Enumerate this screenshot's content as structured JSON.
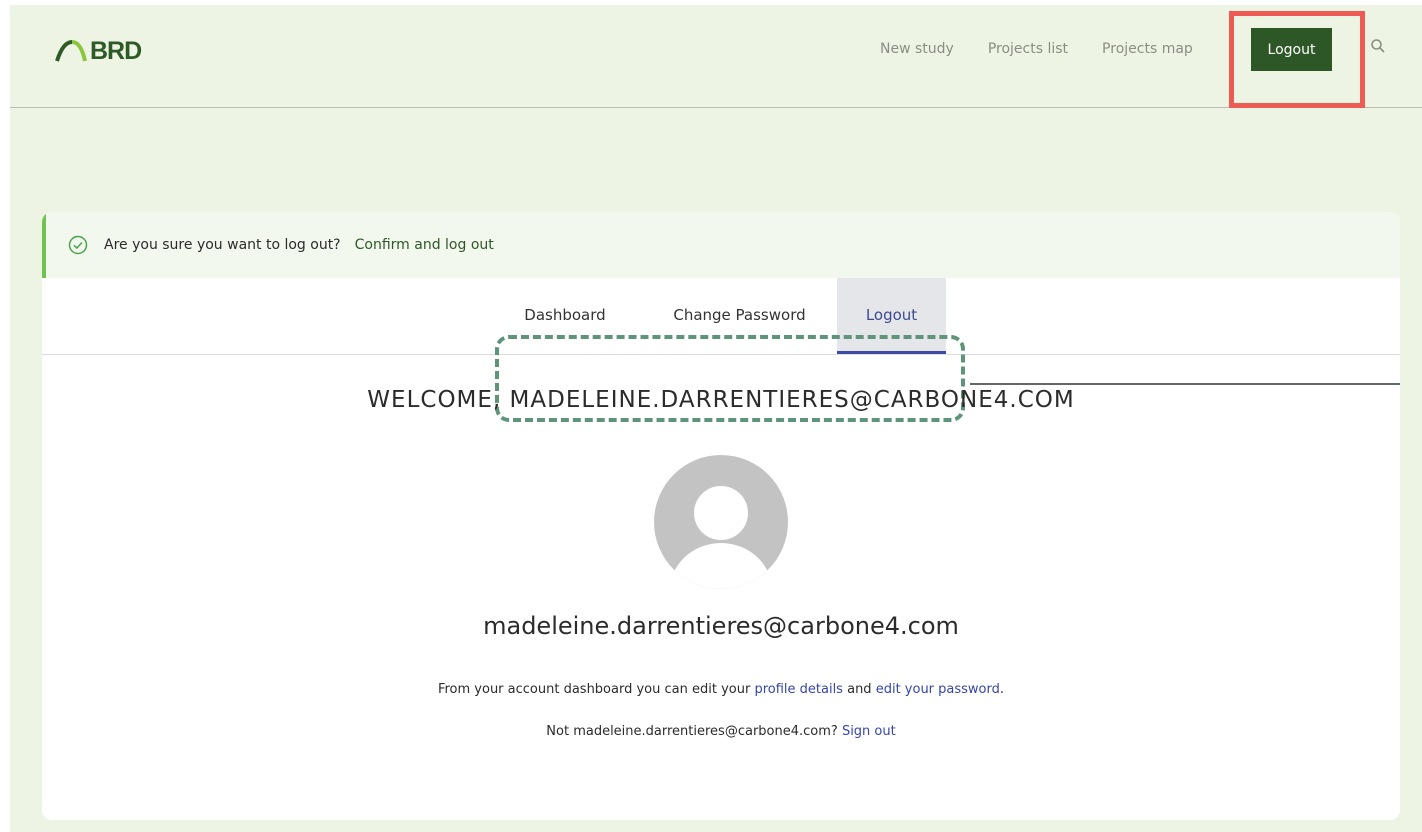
{
  "brand": {
    "logo_text": "BRD",
    "accent": "#2e5727",
    "highlight": "#ee5b55"
  },
  "nav": {
    "items": [
      "New study",
      "Projects list",
      "Projects map"
    ],
    "logout_label": "Logout",
    "search_icon": "search-icon"
  },
  "notice": {
    "icon": "check-circle-icon",
    "message": "Are you sure you want to log out?",
    "confirm_link": "Confirm and log out"
  },
  "tabs": [
    {
      "label": "Dashboard"
    },
    {
      "label": "Change Password"
    },
    {
      "label": "Logout",
      "active": true
    }
  ],
  "account": {
    "welcome": "WELCOME, MADELEINE.DARRENTIERES@CARBONE4.COM",
    "email": "madeleine.darrentieres@carbone4.com",
    "info_prefix": "From your account dashboard you can edit your ",
    "profile_link": "profile details",
    "info_and": " and ",
    "password_link": "edit your password",
    "info_suffix": ".",
    "not_user_text": "Not madeleine.darrentieres@carbone4.com? ",
    "sign_out_link": "Sign out"
  }
}
